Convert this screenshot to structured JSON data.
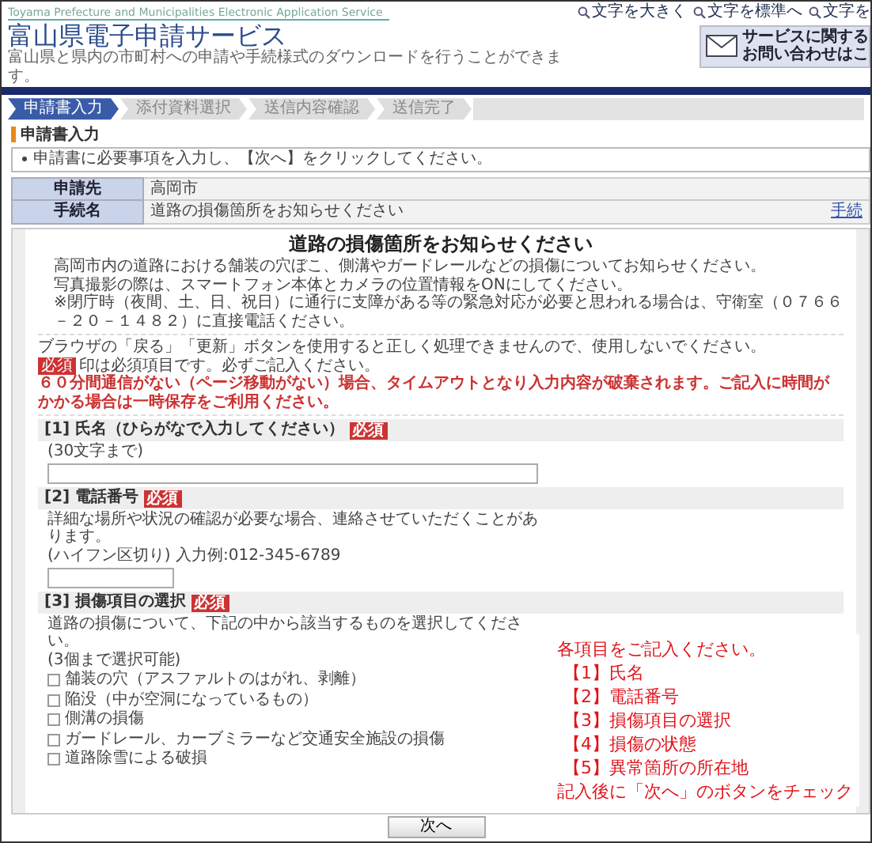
{
  "header": {
    "tagline_en": "Toyama Prefecture and Municipalities Electronic Application Service",
    "title": "富山県電子申請サービス",
    "subtitle": "富山県と県内の市町村への申請や手続様式のダウンロードを行うことができます。",
    "text_size_links": [
      "文字を大きく",
      "文字を標準へ",
      "文字を"
    ],
    "contact_lines": [
      "サービスに関する",
      "お問い合わせはこ"
    ]
  },
  "steps": [
    {
      "label": "申請書入力",
      "selected": true
    },
    {
      "label": "添付資料選択",
      "selected": false
    },
    {
      "label": "送信内容確認",
      "selected": false
    },
    {
      "label": "送信完了",
      "selected": false
    }
  ],
  "page_heading": "申請書入力",
  "instructions": [
    "申請書に必要事項を入力し、【次へ】をクリックしてください。"
  ],
  "info_table": [
    {
      "label": "申請先",
      "value": "高岡市"
    },
    {
      "label": "手続名",
      "value": "道路の損傷箇所をお知らせください",
      "link": "手続"
    }
  ],
  "form": {
    "title": "道路の損傷箇所をお知らせください",
    "intro": [
      "高岡市内の道路における舗装の穴ぼこ、側溝やガードレールなどの損傷についてお知らせください。",
      "写真撮影の際は、スマートフォン本体とカメラの位置情報をONにしてください。",
      "※閉庁時（夜間、土、日、祝日）に通行に支障がある等の緊急対応が必要と思われる場合は、守衛室（０７６６－２０－１４８２）に直接電話ください。"
    ],
    "notices": [
      {
        "kind": "plain",
        "text": "ブラウザの「戻る」「更新」ボタンを使用すると正しく処理できませんので、使用しないでください。"
      },
      {
        "kind": "required_note",
        "badge": "必須",
        "text": "印は必須項目です。必ずご記入ください。"
      },
      {
        "kind": "warning",
        "text": "６０分間通信がない（ページ移動がない）場合、タイムアウトとなり入力内容が破棄されます。ご記入に時間がかかる場合は一時保存をご利用ください。"
      }
    ],
    "sections": [
      {
        "number": "[1]",
        "label": "氏名（ひらがなで入力してください）",
        "badge": "必須",
        "kind": "text_wide",
        "notes": [
          "(30文字まで)"
        ]
      },
      {
        "number": "[2]",
        "label": "電話番号",
        "badge": "必須",
        "kind": "text_short",
        "notes": [
          "詳細な場所や状況の確認が必要な場合、連絡させていただくことがあります。",
          "(ハイフン区切り) 入力例:012-345-6789"
        ]
      },
      {
        "number": "[3]",
        "label": "損傷項目の選択",
        "badge": "必須",
        "kind": "checkboxes",
        "notes": [
          "道路の損傷について、下記の中から該当するものを選択してください。",
          "(3個まで選択可能)"
        ],
        "options": [
          {
            "label": "舗装の穴（アスファルトのはがれ、剥離）",
            "checked": false
          },
          {
            "label": "陥没（中が空洞になっているもの）",
            "checked": false
          },
          {
            "label": "側溝の損傷",
            "checked": false
          },
          {
            "label": "ガードレール、カーブミラーなど交通安全施設の損傷",
            "checked": false
          },
          {
            "label": "道路除雪による破損",
            "checked": false
          }
        ]
      }
    ]
  },
  "annotation": {
    "heading": "各項目をご記入ください。",
    "items": [
      "【1】氏名",
      "【2】電話番号",
      "【3】損傷項目の選択",
      "【4】損傷の状態",
      "【5】異常箇所の所在地"
    ],
    "footer": "記入後に「次へ」のボタンをチェック"
  },
  "next_button": "次へ"
}
